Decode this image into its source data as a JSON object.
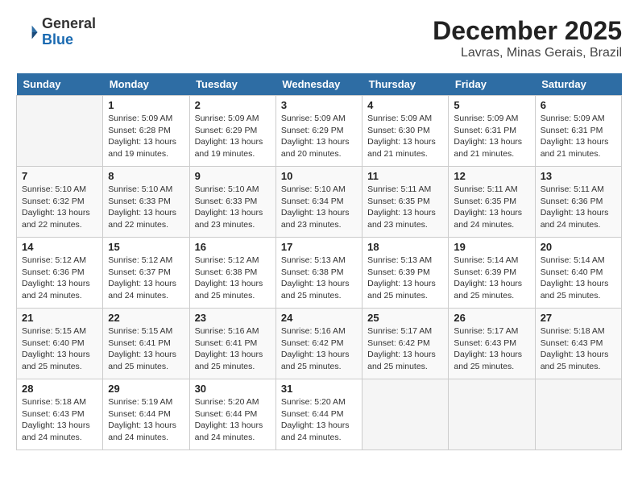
{
  "header": {
    "logo_general": "General",
    "logo_blue": "Blue",
    "month": "December 2025",
    "location": "Lavras, Minas Gerais, Brazil"
  },
  "days_of_week": [
    "Sunday",
    "Monday",
    "Tuesday",
    "Wednesday",
    "Thursday",
    "Friday",
    "Saturday"
  ],
  "weeks": [
    [
      {
        "day": "",
        "info": ""
      },
      {
        "day": "1",
        "info": "Sunrise: 5:09 AM\nSunset: 6:28 PM\nDaylight: 13 hours and 19 minutes."
      },
      {
        "day": "2",
        "info": "Sunrise: 5:09 AM\nSunset: 6:29 PM\nDaylight: 13 hours and 19 minutes."
      },
      {
        "day": "3",
        "info": "Sunrise: 5:09 AM\nSunset: 6:29 PM\nDaylight: 13 hours and 20 minutes."
      },
      {
        "day": "4",
        "info": "Sunrise: 5:09 AM\nSunset: 6:30 PM\nDaylight: 13 hours and 21 minutes."
      },
      {
        "day": "5",
        "info": "Sunrise: 5:09 AM\nSunset: 6:31 PM\nDaylight: 13 hours and 21 minutes."
      },
      {
        "day": "6",
        "info": "Sunrise: 5:09 AM\nSunset: 6:31 PM\nDaylight: 13 hours and 21 minutes."
      }
    ],
    [
      {
        "day": "7",
        "info": "Sunrise: 5:10 AM\nSunset: 6:32 PM\nDaylight: 13 hours and 22 minutes."
      },
      {
        "day": "8",
        "info": "Sunrise: 5:10 AM\nSunset: 6:33 PM\nDaylight: 13 hours and 22 minutes."
      },
      {
        "day": "9",
        "info": "Sunrise: 5:10 AM\nSunset: 6:33 PM\nDaylight: 13 hours and 23 minutes."
      },
      {
        "day": "10",
        "info": "Sunrise: 5:10 AM\nSunset: 6:34 PM\nDaylight: 13 hours and 23 minutes."
      },
      {
        "day": "11",
        "info": "Sunrise: 5:11 AM\nSunset: 6:35 PM\nDaylight: 13 hours and 23 minutes."
      },
      {
        "day": "12",
        "info": "Sunrise: 5:11 AM\nSunset: 6:35 PM\nDaylight: 13 hours and 24 minutes."
      },
      {
        "day": "13",
        "info": "Sunrise: 5:11 AM\nSunset: 6:36 PM\nDaylight: 13 hours and 24 minutes."
      }
    ],
    [
      {
        "day": "14",
        "info": "Sunrise: 5:12 AM\nSunset: 6:36 PM\nDaylight: 13 hours and 24 minutes."
      },
      {
        "day": "15",
        "info": "Sunrise: 5:12 AM\nSunset: 6:37 PM\nDaylight: 13 hours and 24 minutes."
      },
      {
        "day": "16",
        "info": "Sunrise: 5:12 AM\nSunset: 6:38 PM\nDaylight: 13 hours and 25 minutes."
      },
      {
        "day": "17",
        "info": "Sunrise: 5:13 AM\nSunset: 6:38 PM\nDaylight: 13 hours and 25 minutes."
      },
      {
        "day": "18",
        "info": "Sunrise: 5:13 AM\nSunset: 6:39 PM\nDaylight: 13 hours and 25 minutes."
      },
      {
        "day": "19",
        "info": "Sunrise: 5:14 AM\nSunset: 6:39 PM\nDaylight: 13 hours and 25 minutes."
      },
      {
        "day": "20",
        "info": "Sunrise: 5:14 AM\nSunset: 6:40 PM\nDaylight: 13 hours and 25 minutes."
      }
    ],
    [
      {
        "day": "21",
        "info": "Sunrise: 5:15 AM\nSunset: 6:40 PM\nDaylight: 13 hours and 25 minutes."
      },
      {
        "day": "22",
        "info": "Sunrise: 5:15 AM\nSunset: 6:41 PM\nDaylight: 13 hours and 25 minutes."
      },
      {
        "day": "23",
        "info": "Sunrise: 5:16 AM\nSunset: 6:41 PM\nDaylight: 13 hours and 25 minutes."
      },
      {
        "day": "24",
        "info": "Sunrise: 5:16 AM\nSunset: 6:42 PM\nDaylight: 13 hours and 25 minutes."
      },
      {
        "day": "25",
        "info": "Sunrise: 5:17 AM\nSunset: 6:42 PM\nDaylight: 13 hours and 25 minutes."
      },
      {
        "day": "26",
        "info": "Sunrise: 5:17 AM\nSunset: 6:43 PM\nDaylight: 13 hours and 25 minutes."
      },
      {
        "day": "27",
        "info": "Sunrise: 5:18 AM\nSunset: 6:43 PM\nDaylight: 13 hours and 25 minutes."
      }
    ],
    [
      {
        "day": "28",
        "info": "Sunrise: 5:18 AM\nSunset: 6:43 PM\nDaylight: 13 hours and 24 minutes."
      },
      {
        "day": "29",
        "info": "Sunrise: 5:19 AM\nSunset: 6:44 PM\nDaylight: 13 hours and 24 minutes."
      },
      {
        "day": "30",
        "info": "Sunrise: 5:20 AM\nSunset: 6:44 PM\nDaylight: 13 hours and 24 minutes."
      },
      {
        "day": "31",
        "info": "Sunrise: 5:20 AM\nSunset: 6:44 PM\nDaylight: 13 hours and 24 minutes."
      },
      {
        "day": "",
        "info": ""
      },
      {
        "day": "",
        "info": ""
      },
      {
        "day": "",
        "info": ""
      }
    ]
  ]
}
